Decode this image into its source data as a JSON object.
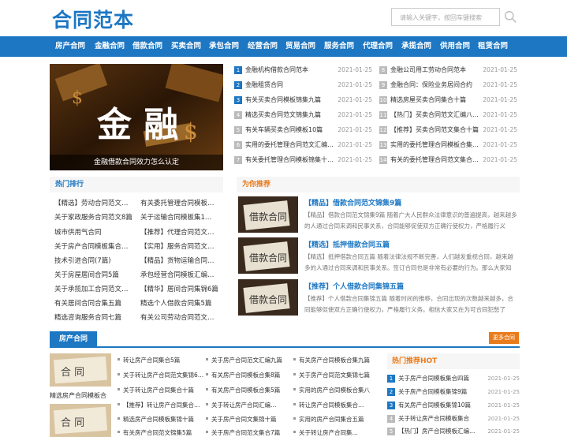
{
  "header": {
    "logo": "合同范本",
    "search_placeholder": "请输入关键字，按回车键搜索"
  },
  "nav": [
    "房产合同",
    "金融合同",
    "借款合同",
    "买卖合同",
    "承包合同",
    "经营合同",
    "贸易合同",
    "服务合同",
    "代理合同",
    "承揽合同",
    "供用合同",
    "租赁合同"
  ],
  "hero": {
    "big_text": "金 融",
    "caption": "金融借款合同效力怎么认定"
  },
  "toplist_left": [
    {
      "n": "1",
      "t": "金融机构借款合同范本",
      "d": "2021-01-25"
    },
    {
      "n": "2",
      "t": "金融租赁合同",
      "d": "2021-01-25"
    },
    {
      "n": "3",
      "t": "有关买卖合同模板锦集九篇",
      "d": "2021-01-25"
    },
    {
      "n": "4",
      "t": "精选买卖合同范文锦集九篇",
      "d": "2021-01-25"
    },
    {
      "n": "5",
      "t": "有关车辆买卖合同模板10篇",
      "d": "2021-01-25"
    },
    {
      "n": "6",
      "t": "实用的委托管理合同范文汇编…",
      "d": "2021-01-25"
    },
    {
      "n": "7",
      "t": "有关委托管理合同模板锦集十…",
      "d": "2021-01-25"
    }
  ],
  "toplist_right": [
    {
      "n": "8",
      "t": "金融公司用工劳动合同范本",
      "d": "2021-01-25"
    },
    {
      "n": "9",
      "t": "金融合同：保险业务居间合约",
      "d": "2021-01-25"
    },
    {
      "n": "10",
      "t": "精选房屋买卖合同集合十篇",
      "d": "2021-01-25"
    },
    {
      "n": "11",
      "t": "【热门】买卖合同范文汇编八…",
      "d": "2021-01-25"
    },
    {
      "n": "12",
      "t": "【推荐】买卖合同范文集合十篇",
      "d": "2021-01-25"
    },
    {
      "n": "13",
      "t": "实用的委托管理合同模板合集…",
      "d": "2021-01-25"
    },
    {
      "n": "14",
      "t": "有关的委托管理合同范文集合…",
      "d": "2021-01-25"
    }
  ],
  "hot_rank": {
    "title": "热门排行",
    "col1": [
      "【精选】劳动合同范文…",
      "关于家政服务合同范文8篇",
      "城市供用气合同",
      "关于房产合同模板集合…",
      "技术引进合同(7篇)",
      "关于房屋居间合同5篇",
      "关于承揽加工合同范文…",
      "有关居间合同合集五篇",
      "精选咨询服务合同七篇"
    ],
    "col2": [
      "有关委托管理合同模板…",
      "关于运输合同模板集1…",
      "【推荐】代理合同范文…",
      "【实用】服务合同范文…",
      "【精品】货物运输合同…",
      "承包经营合同模板汇编…",
      "【精华】居间合同集锦6篇",
      "精选个人借款合同集5篇",
      "有关公司劳动合同范文…"
    ]
  },
  "recommend": {
    "title": "为你推荐",
    "items": [
      {
        "title": "【精品】借款合同范文锦集9篇",
        "desc": "【精品】借款合同范文锦集9篇 随着广大人民群众法律意识的普遍提高，越来越多的人通过合同来调和民事关系，合同能够促使双方正确行使权力，严格履行义"
      },
      {
        "title": "【精选】抵押借款合同五篇",
        "desc": "【精选】抵押借款合同五篇 随着法律法规不断完善，人们越发重视合同，越来越多的人通过合同来调和民事关系。签订合同也是非常有必要的行为。那么大家知"
      },
      {
        "title": "【推荐】个人借款合同集锦五篇",
        "desc": "【推荐】个人借款合同集锦五篇 随着时间的推移，合同出现的次数越来越多，合同能够促使双方正确行使权力，严格履行义务。相信大家又在为可合同犯愁了"
      }
    ],
    "img_text": "借款合同"
  },
  "bottom": {
    "tab": "房产合同",
    "more": "更多合同",
    "img_text": "合 同",
    "img_caption": "精选房产合同模板合",
    "col1": [
      "转让房产合同集合5篇",
      "关于转让房产合同范文集锦6…",
      "关于转让房产合同集合十篇",
      "【推荐】转让房产合同集合…",
      "精选房产合同模板集锦十篇",
      "有关房产合同范文锦集5篇"
    ],
    "col2": [
      "关于房产合同范文汇编九篇",
      "有关房产合同模板合集8篇",
      "有关房产合同模板合集5篇",
      "关于转让房产合同汇编…",
      "关于房产合同文集锦十篇",
      "关于房产合同范文集合7篇"
    ],
    "col3": [
      "有关房产合同模板合集九篇",
      "关于房产合同范文集锦七篇",
      "实用的房产合同模板合集八",
      "转让房产合同模板集合…",
      "实用的房产合同集合五篇",
      "关于转让房产合同集…"
    ]
  },
  "hot_recommend": {
    "title": "热门推荐HOT",
    "items": [
      {
        "n": "1",
        "t": "关于房产合同模板集合四篇",
        "d": "2021-01-25"
      },
      {
        "n": "2",
        "t": "关于房产合同模板集锦9篇",
        "d": "2021-01-25"
      },
      {
        "n": "3",
        "t": "有关房产合同模板集锦10篇",
        "d": "2021-01-25"
      },
      {
        "n": "4",
        "t": "关于转让房产合同模板集合",
        "d": "2021-01-25"
      },
      {
        "n": "5",
        "t": "【热门】房产合同模板汇编…",
        "d": "2021-01-25"
      }
    ]
  },
  "colors": {
    "brand": "#1d77c3",
    "accent": "#e87b1b"
  }
}
